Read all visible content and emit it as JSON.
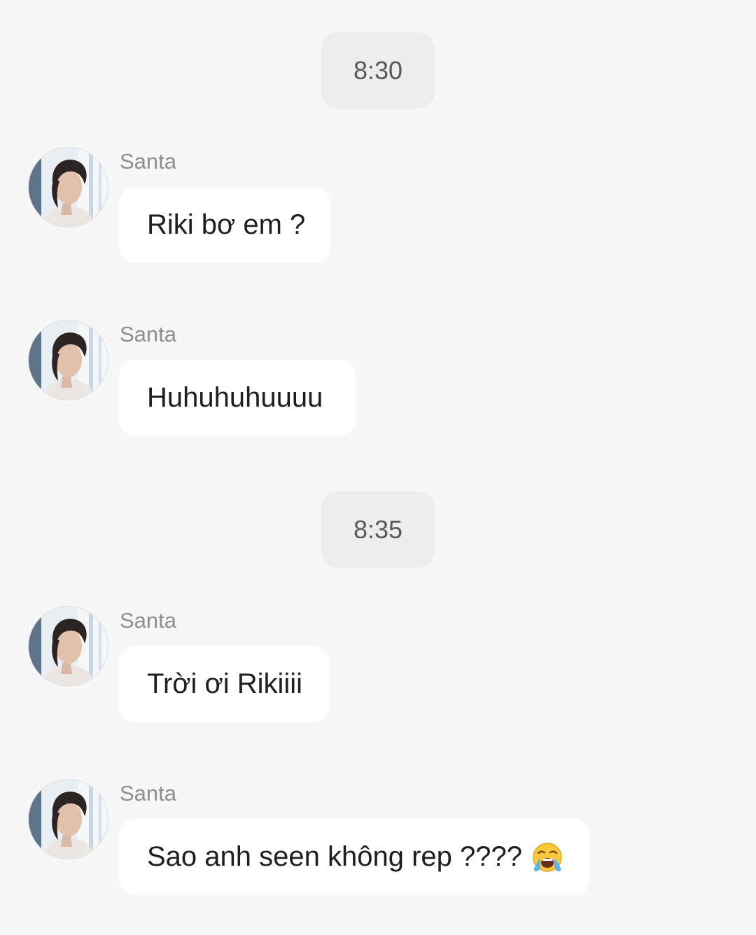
{
  "chat": {
    "timestamps": [
      "8:30",
      "8:35"
    ],
    "messages": [
      {
        "sender": "Santa",
        "text": "Riki bơ em ?"
      },
      {
        "sender": "Santa",
        "text": "Huhuhuhuuuu"
      },
      {
        "sender": "Santa",
        "text": "Trời ơi Rikiiii"
      },
      {
        "sender": "Santa",
        "text": "Sao anh seen không rep ????",
        "emoji": "loudly-crying-face-icon"
      }
    ]
  },
  "colors": {
    "background": "#f7f7f7",
    "bubble": "#ffffff",
    "timestamp_pill": "#ededed",
    "sender_name": "#8e8e8e"
  }
}
